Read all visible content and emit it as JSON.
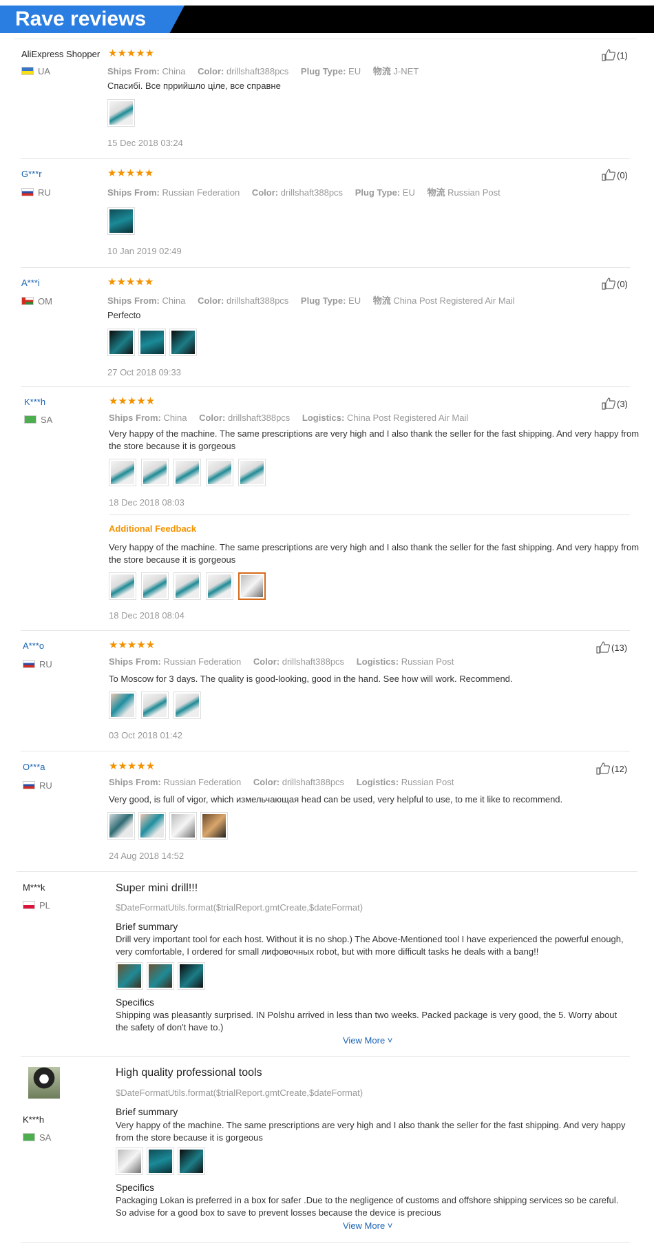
{
  "banner": {
    "title": "Rave reviews"
  },
  "reviews": [
    {
      "user": "AliExpress Shopper",
      "country": "UA",
      "stars": "★★★★★",
      "meta": [
        [
          "Ships From:",
          "China"
        ],
        [
          "Color:",
          "drillshaft388pcs"
        ],
        [
          "Plug Type:",
          "EU"
        ],
        [
          "物流",
          "J-NET"
        ]
      ],
      "text": "Спасибі. Все пррийшло ціле, все справне",
      "date": "15 Dec 2018 03:24",
      "likes": "(1)"
    },
    {
      "user": "G***r",
      "country": "RU",
      "stars": "★★★★★",
      "meta": [
        [
          "Ships From:",
          "Russian Federation"
        ],
        [
          "Color:",
          "drillshaft388pcs"
        ],
        [
          "Plug Type:",
          "EU"
        ],
        [
          "物流",
          "Russian Post"
        ]
      ],
      "text": "",
      "date": "10 Jan 2019 02:49",
      "likes": "(0)"
    },
    {
      "user": "A***i",
      "country": "OM",
      "stars": "★★★★★",
      "meta": [
        [
          "Ships From:",
          "China"
        ],
        [
          "Color:",
          "drillshaft388pcs"
        ],
        [
          "Plug Type:",
          "EU"
        ],
        [
          "物流",
          "China Post Registered Air Mail"
        ]
      ],
      "text": "Perfecto",
      "date": "27 Oct 2018 09:33",
      "likes": "(0)"
    },
    {
      "user": "K***h",
      "country": "SA",
      "stars": "★★★★★",
      "meta": [
        [
          "Ships From:",
          "China"
        ],
        [
          "Color:",
          "drillshaft388pcs"
        ],
        [
          "Logistics:",
          "China Post Registered Air Mail"
        ]
      ],
      "text": "Very happy of the machine. The same prescriptions are very high and I also thank the seller for the fast shipping. And very happy from the store because it is gorgeous",
      "date": "18 Dec 2018 08:03",
      "likes": "(3)",
      "additional_label": "Additional Feedback",
      "additional_text": "Very happy of the machine. The same prescriptions are very high and I also thank the seller for the fast shipping. And very happy from the store because it is gorgeous",
      "additional_date": "18 Dec 2018 08:04"
    },
    {
      "user": "A***o",
      "country": "RU",
      "stars": "★★★★★",
      "meta": [
        [
          "Ships From:",
          "Russian Federation"
        ],
        [
          "Color:",
          "drillshaft388pcs"
        ],
        [
          "Logistics:",
          "Russian Post"
        ]
      ],
      "text": "To Moscow for 3 days. The quality is good-looking, good in the hand. See how will work. Recommend.",
      "date": "03 Oct 2018 01:42",
      "likes": "(13)"
    },
    {
      "user": "O***a",
      "country": "RU",
      "stars": "★★★★★",
      "meta": [
        [
          "Ships From:",
          "Russian Federation"
        ],
        [
          "Color:",
          "drillshaft388pcs"
        ],
        [
          "Logistics:",
          "Russian Post"
        ]
      ],
      "text": "Very good, is full of vigor, which измельчающая head can be used, very helpful to use, to me it like to recommend.",
      "date": "24 Aug 2018 14:52",
      "likes": "(12)"
    }
  ],
  "trials": [
    {
      "user": "M***k",
      "country": "PL",
      "title": "Super mini drill!!!",
      "template": "$DateFormatUtils.format($trialReport.gmtCreate,$dateFormat)",
      "brief_label": "Brief summary",
      "brief": "Drill very important tool for each host. Without it is no shop.) The Above-Mentioned tool I have experienced the powerful enough, very comfortable, I ordered for small лифовочных robot, but with more difficult tasks he deals with a bang!!",
      "specifics_label": "Specifics",
      "specifics": "Shipping was pleasantly surprised. IN Polshu arrived in less than two weeks. Packed package is very good, the 5. Worry about the safety of don't have to.)",
      "view_more": "View More ˅"
    },
    {
      "user": "K***h",
      "country": "SA",
      "title": "High quality professional tools",
      "template": "$DateFormatUtils.format($trialReport.gmtCreate,$dateFormat)",
      "brief_label": "Brief summary",
      "brief": "Very happy of the machine. The same prescriptions are very high and I also thank the seller for the fast shipping. And very happy from the store because it is gorgeous",
      "specifics_label": "Specifics",
      "specifics": "Packaging Lokan is preferred in a box for safer .Due to the negligence of customs and offshore shipping services so be careful. So advise for a good box to save to prevent losses because the device is precious",
      "view_more": "View More ˅"
    }
  ]
}
